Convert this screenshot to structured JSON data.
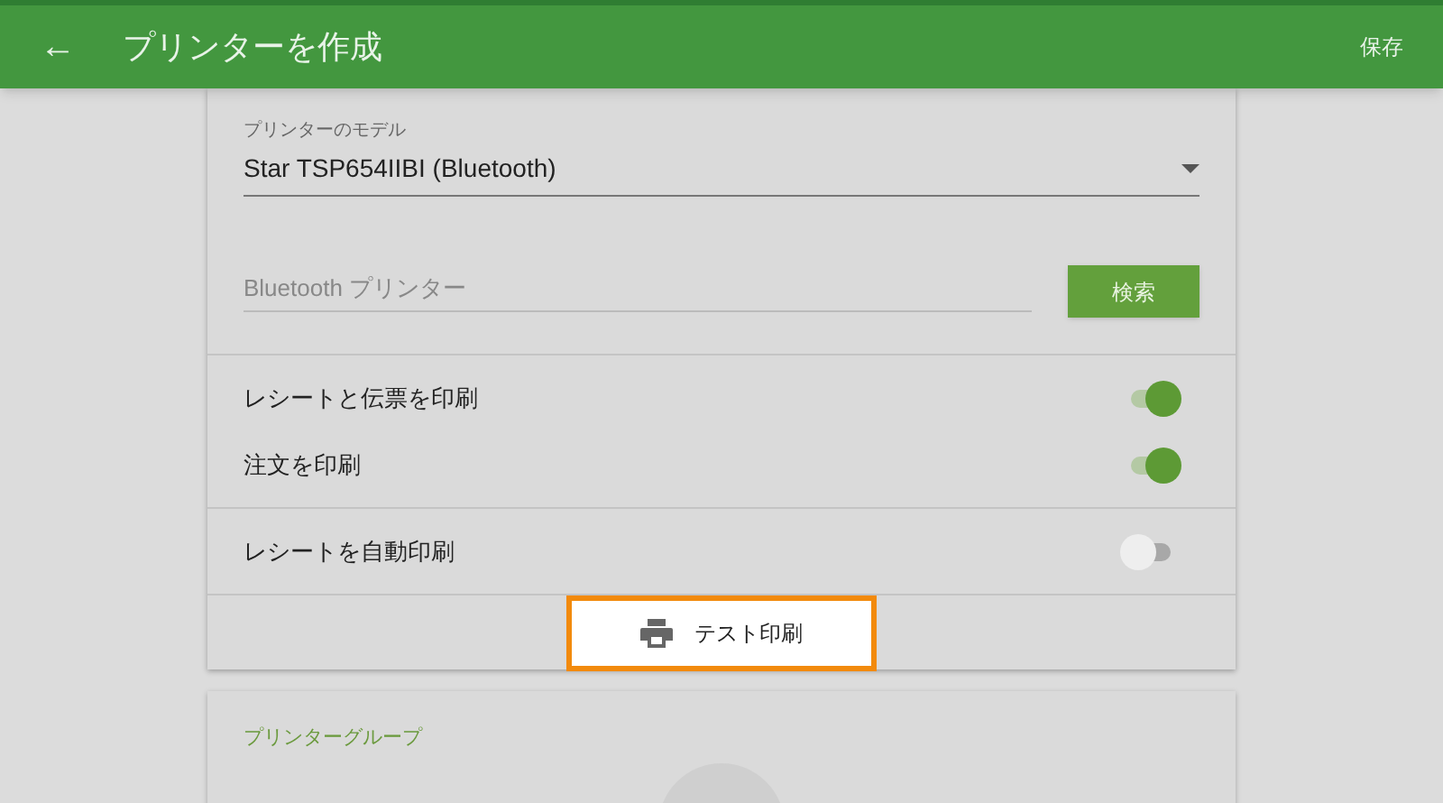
{
  "app_bar": {
    "back": "←",
    "title": "プリンターを作成",
    "action": "保存"
  },
  "model_field": {
    "label": "プリンターのモデル",
    "value": "Star TSP654IIBI (Bluetooth)"
  },
  "bluetooth_field": {
    "placeholder": "Bluetooth プリンター"
  },
  "search_button": "検索",
  "toggles": [
    {
      "label": "レシートと伝票を印刷",
      "on": true
    },
    {
      "label": "注文を印刷",
      "on": true
    },
    {
      "label": "レシートを自動印刷",
      "on": false
    }
  ],
  "test_print_button": {
    "label": "テスト印刷",
    "highlighted": true
  },
  "printer_group": {
    "title": "プリンターグループ"
  }
}
